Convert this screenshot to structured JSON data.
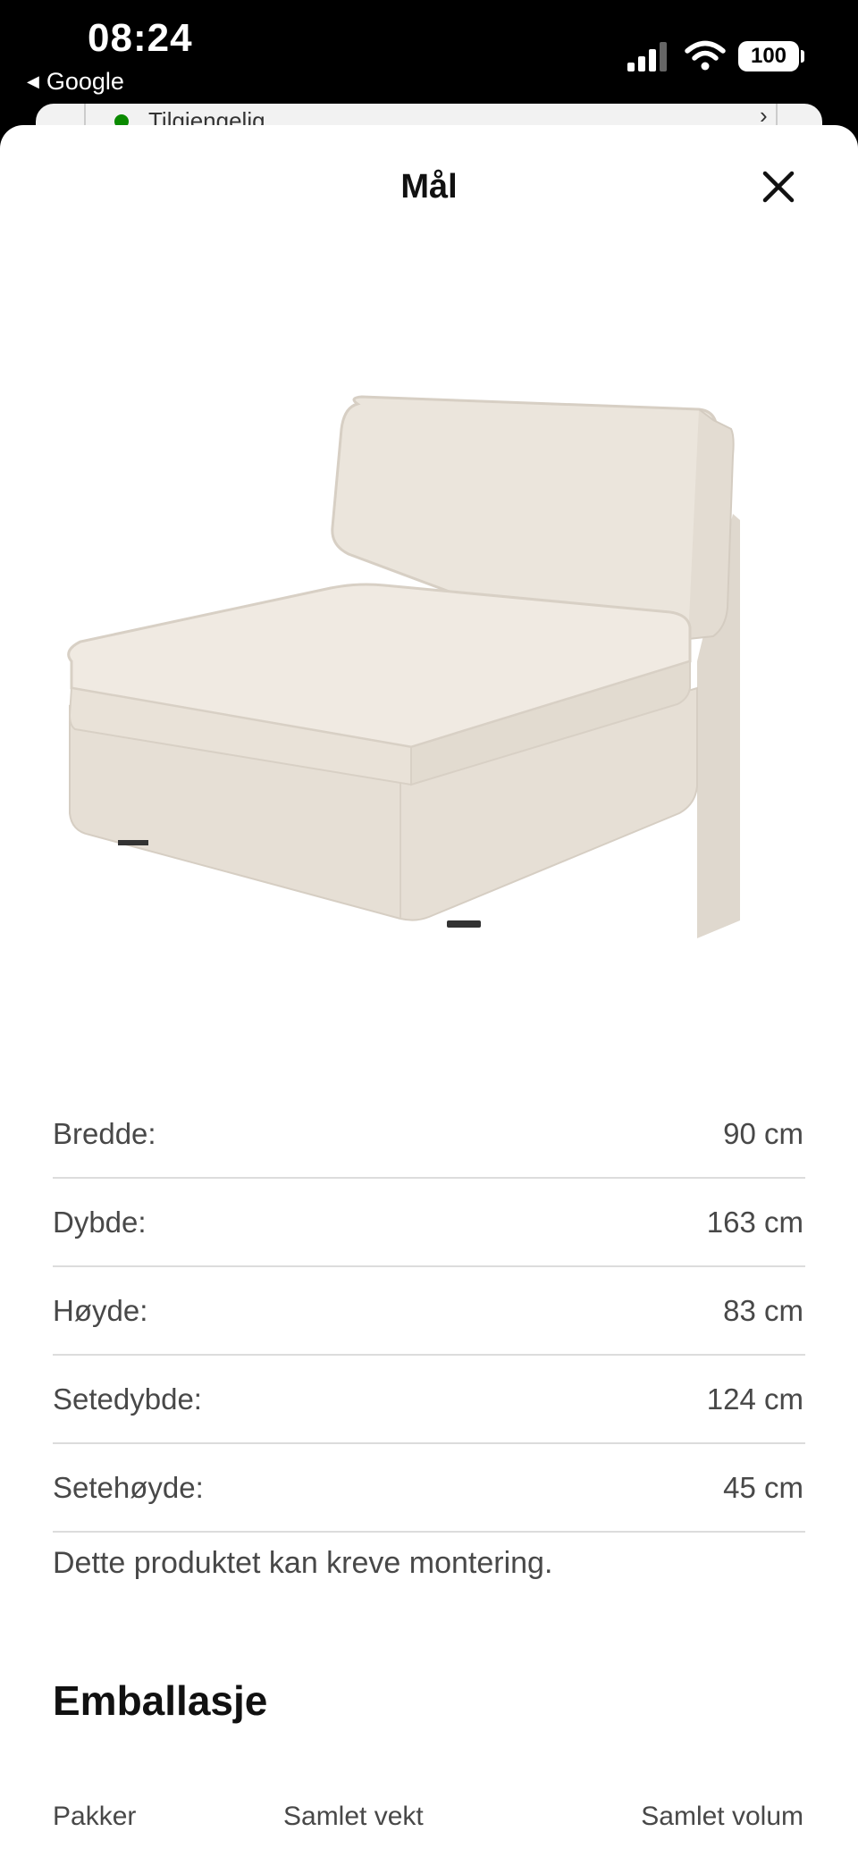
{
  "status_bar": {
    "time": "08:24",
    "back_app": "Google",
    "battery": "100"
  },
  "background_card": {
    "availability": "Tilgjengelig"
  },
  "sheet": {
    "title": "Mål"
  },
  "dimensions": [
    {
      "label": "Bredde:",
      "value": "90 cm"
    },
    {
      "label": "Dybde:",
      "value": "163 cm"
    },
    {
      "label": "Høyde:",
      "value": "83 cm"
    },
    {
      "label": "Setedybde:",
      "value": "124 cm"
    },
    {
      "label": "Setehøyde:",
      "value": "45 cm"
    }
  ],
  "assembly_note": "Dette produktet kan kreve montering.",
  "packaging": {
    "heading": "Emballasje",
    "columns": [
      "Pakker",
      "Samlet vekt",
      "Samlet volum"
    ]
  },
  "colors": {
    "availability_dot": "#0a8a00",
    "sofa_fabric": "#ece6dd"
  },
  "icons": [
    "back-triangle-icon",
    "signal-icon",
    "wifi-icon",
    "battery-icon",
    "close-icon",
    "chevron-icon"
  ]
}
